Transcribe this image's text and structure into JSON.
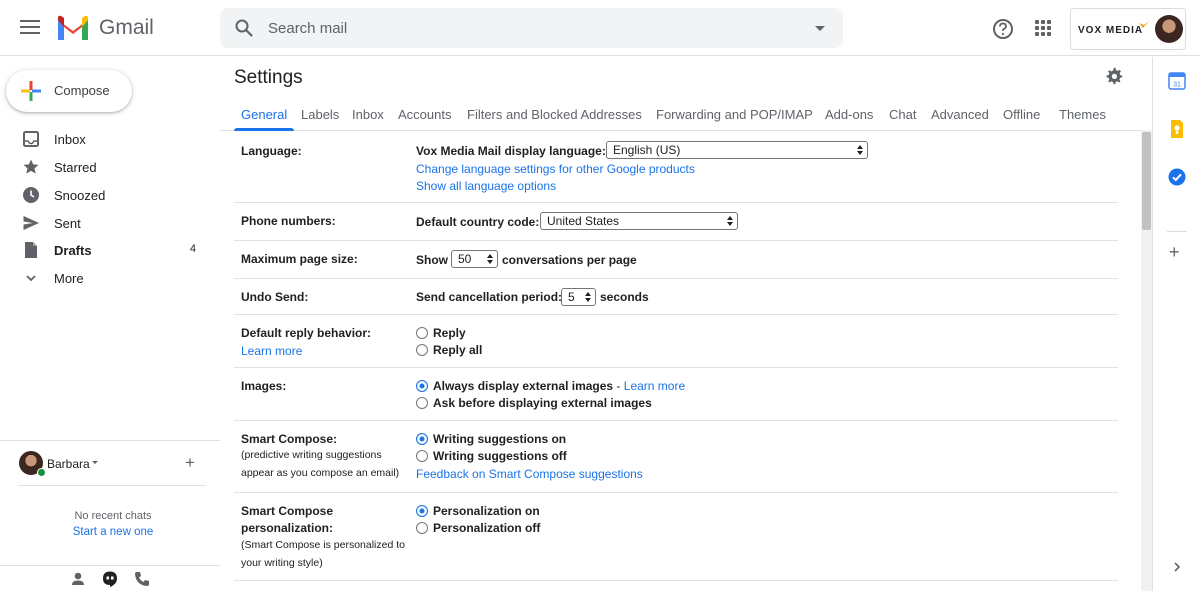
{
  "header": {
    "brand": "Gmail",
    "search_placeholder": "Search mail",
    "account_brand": "VOX MEDIA"
  },
  "nav": {
    "compose_label": "Compose",
    "items": [
      {
        "label": "Inbox",
        "icon": "inbox-icon",
        "count": ""
      },
      {
        "label": "Starred",
        "icon": "star-icon",
        "count": ""
      },
      {
        "label": "Snoozed",
        "icon": "clock-icon",
        "count": ""
      },
      {
        "label": "Sent",
        "icon": "send-icon",
        "count": ""
      },
      {
        "label": "Drafts",
        "icon": "draft-icon",
        "count": "4"
      },
      {
        "label": "More",
        "icon": "chevron-down-icon",
        "count": ""
      }
    ]
  },
  "chat": {
    "user": "Barbara",
    "no_chats": "No recent chats",
    "start_new": "Start a new one"
  },
  "settings": {
    "title": "Settings",
    "tabs": [
      "General",
      "Labels",
      "Inbox",
      "Accounts",
      "Filters and Blocked Addresses",
      "Forwarding and POP/IMAP",
      "Add-ons",
      "Chat",
      "Advanced",
      "Offline",
      "Themes"
    ],
    "language": {
      "label": "Language:",
      "display_label": "Vox Media Mail display language:",
      "display_value": "English (US)",
      "link_other": "Change language settings for other Google products",
      "link_all": "Show all language options"
    },
    "phone": {
      "label": "Phone numbers:",
      "country_label": "Default country code:",
      "country_value": "United States"
    },
    "page_size": {
      "label": "Maximum page size:",
      "show": "Show",
      "value": "50",
      "suffix": "conversations per page"
    },
    "undo_send": {
      "label": "Undo Send:",
      "period_label": "Send cancellation period:",
      "value": "5",
      "suffix": "seconds"
    },
    "reply": {
      "label": "Default reply behavior:",
      "learn_more": "Learn more",
      "options": [
        "Reply",
        "Reply all"
      ]
    },
    "images": {
      "label": "Images:",
      "option_always": "Always display external images",
      "separator": " - ",
      "learn_more": "Learn more",
      "option_ask": "Ask before displaying external images"
    },
    "smart_compose": {
      "label": "Smart Compose:",
      "sub_line1": "(predictive writing suggestions",
      "sub_line2": "appear as you compose an email)",
      "option_on": "Writing suggestions on",
      "option_off": "Writing suggestions off",
      "feedback": "Feedback on Smart Compose suggestions"
    },
    "personalization": {
      "label_line1": "Smart Compose",
      "label_line2": "personalization:",
      "sub_line1": "(Smart Compose is personalized to",
      "sub_line2": "your writing style)",
      "option_on": "Personalization on",
      "option_off": "Personalization off"
    }
  },
  "colors": {
    "accent": "#1a73e8",
    "text": "#202124",
    "muted": "#5f6368"
  }
}
